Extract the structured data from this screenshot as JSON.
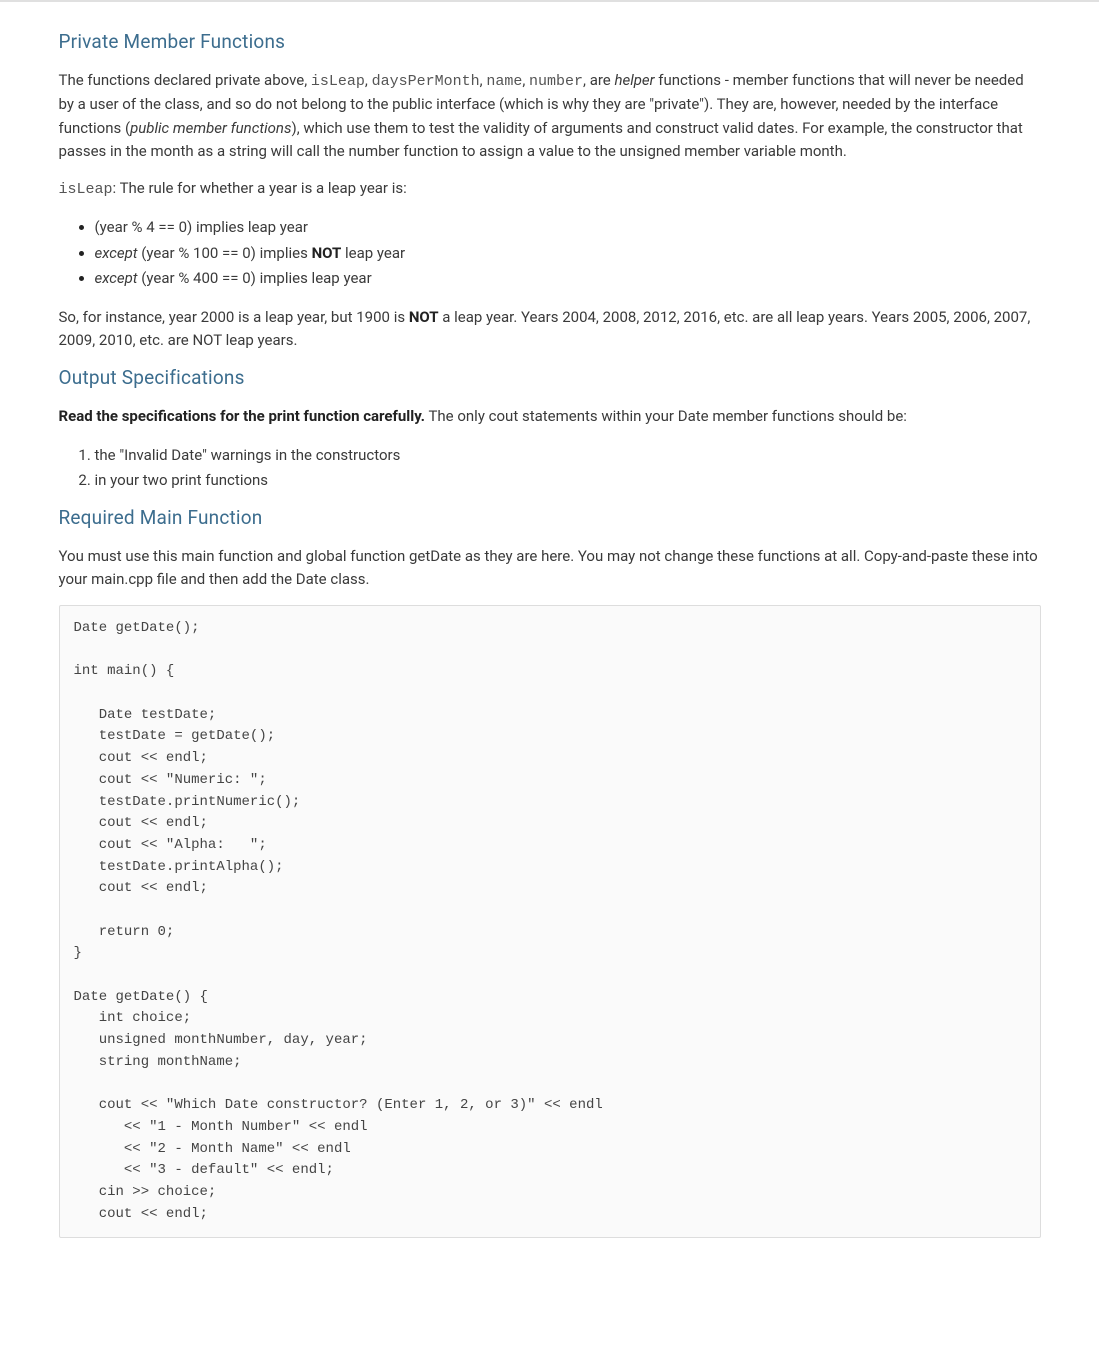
{
  "section1": {
    "heading": "Private Member Functions",
    "p1_prefix": "The functions declared private above, ",
    "p1_code1": "isLeap",
    "p1_sep1": ", ",
    "p1_code2": "daysPerMonth",
    "p1_sep2": ", ",
    "p1_code3": "name",
    "p1_sep3": ", ",
    "p1_code4": "number",
    "p1_sep4": ", are ",
    "p1_em": "helper",
    "p1_tail": " functions - member functions that will never be needed by a user of the class, and so do not belong to the public interface (which is why they are \"private\"). They are, however, needed by the interface functions (",
    "p1_em2": "public member functions",
    "p1_tail2": "), which use them to test the validity of arguments and construct valid dates. For example, the constructor that passes in the month as a string will call the number function to assign a value to the unsigned member variable month.",
    "p2_code": "isLeap",
    "p2_text": ": The rule for whether a year is a leap year is:",
    "rules": {
      "r1": "(year % 4 == 0) implies leap year",
      "r2_em": "except",
      "r2_mid": " (year % 100 == 0) implies ",
      "r2_strong": "NOT",
      "r2_tail": " leap year",
      "r3_em": "except",
      "r3_tail": " (year % 400 == 0) implies leap year"
    },
    "p3_a": "So, for instance, year 2000 is a leap year, but 1900 is ",
    "p3_strong": "NOT",
    "p3_b": " a leap year. Years 2004, 2008, 2012, 2016, etc. are all leap years. Years 2005, 2006, 2007, 2009, 2010, etc. are NOT leap years."
  },
  "section2": {
    "heading": "Output Specifications",
    "p1_strong": "Read the specifications for the print function carefully.",
    "p1_tail": " The only cout statements within your Date member functions should be:",
    "items": {
      "i1": "the \"Invalid Date\" warnings in the constructors",
      "i2": "in your two print functions"
    }
  },
  "section3": {
    "heading": "Required Main Function",
    "p1": "You must use this main function and global function getDate as they are here. You may not change these functions at all. Copy-and-paste these into your main.cpp file and then add the Date class.",
    "code": "Date getDate();\n\nint main() {\n\n   Date testDate;\n   testDate = getDate();\n   cout << endl;\n   cout << \"Numeric: \";\n   testDate.printNumeric();\n   cout << endl;\n   cout << \"Alpha:   \";\n   testDate.printAlpha();\n   cout << endl;\n\n   return 0;\n}\n\nDate getDate() {\n   int choice;\n   unsigned monthNumber, day, year;\n   string monthName;\n\n   cout << \"Which Date constructor? (Enter 1, 2, or 3)\" << endl\n      << \"1 - Month Number\" << endl\n      << \"2 - Month Name\" << endl\n      << \"3 - default\" << endl;\n   cin >> choice;\n   cout << endl;"
  }
}
